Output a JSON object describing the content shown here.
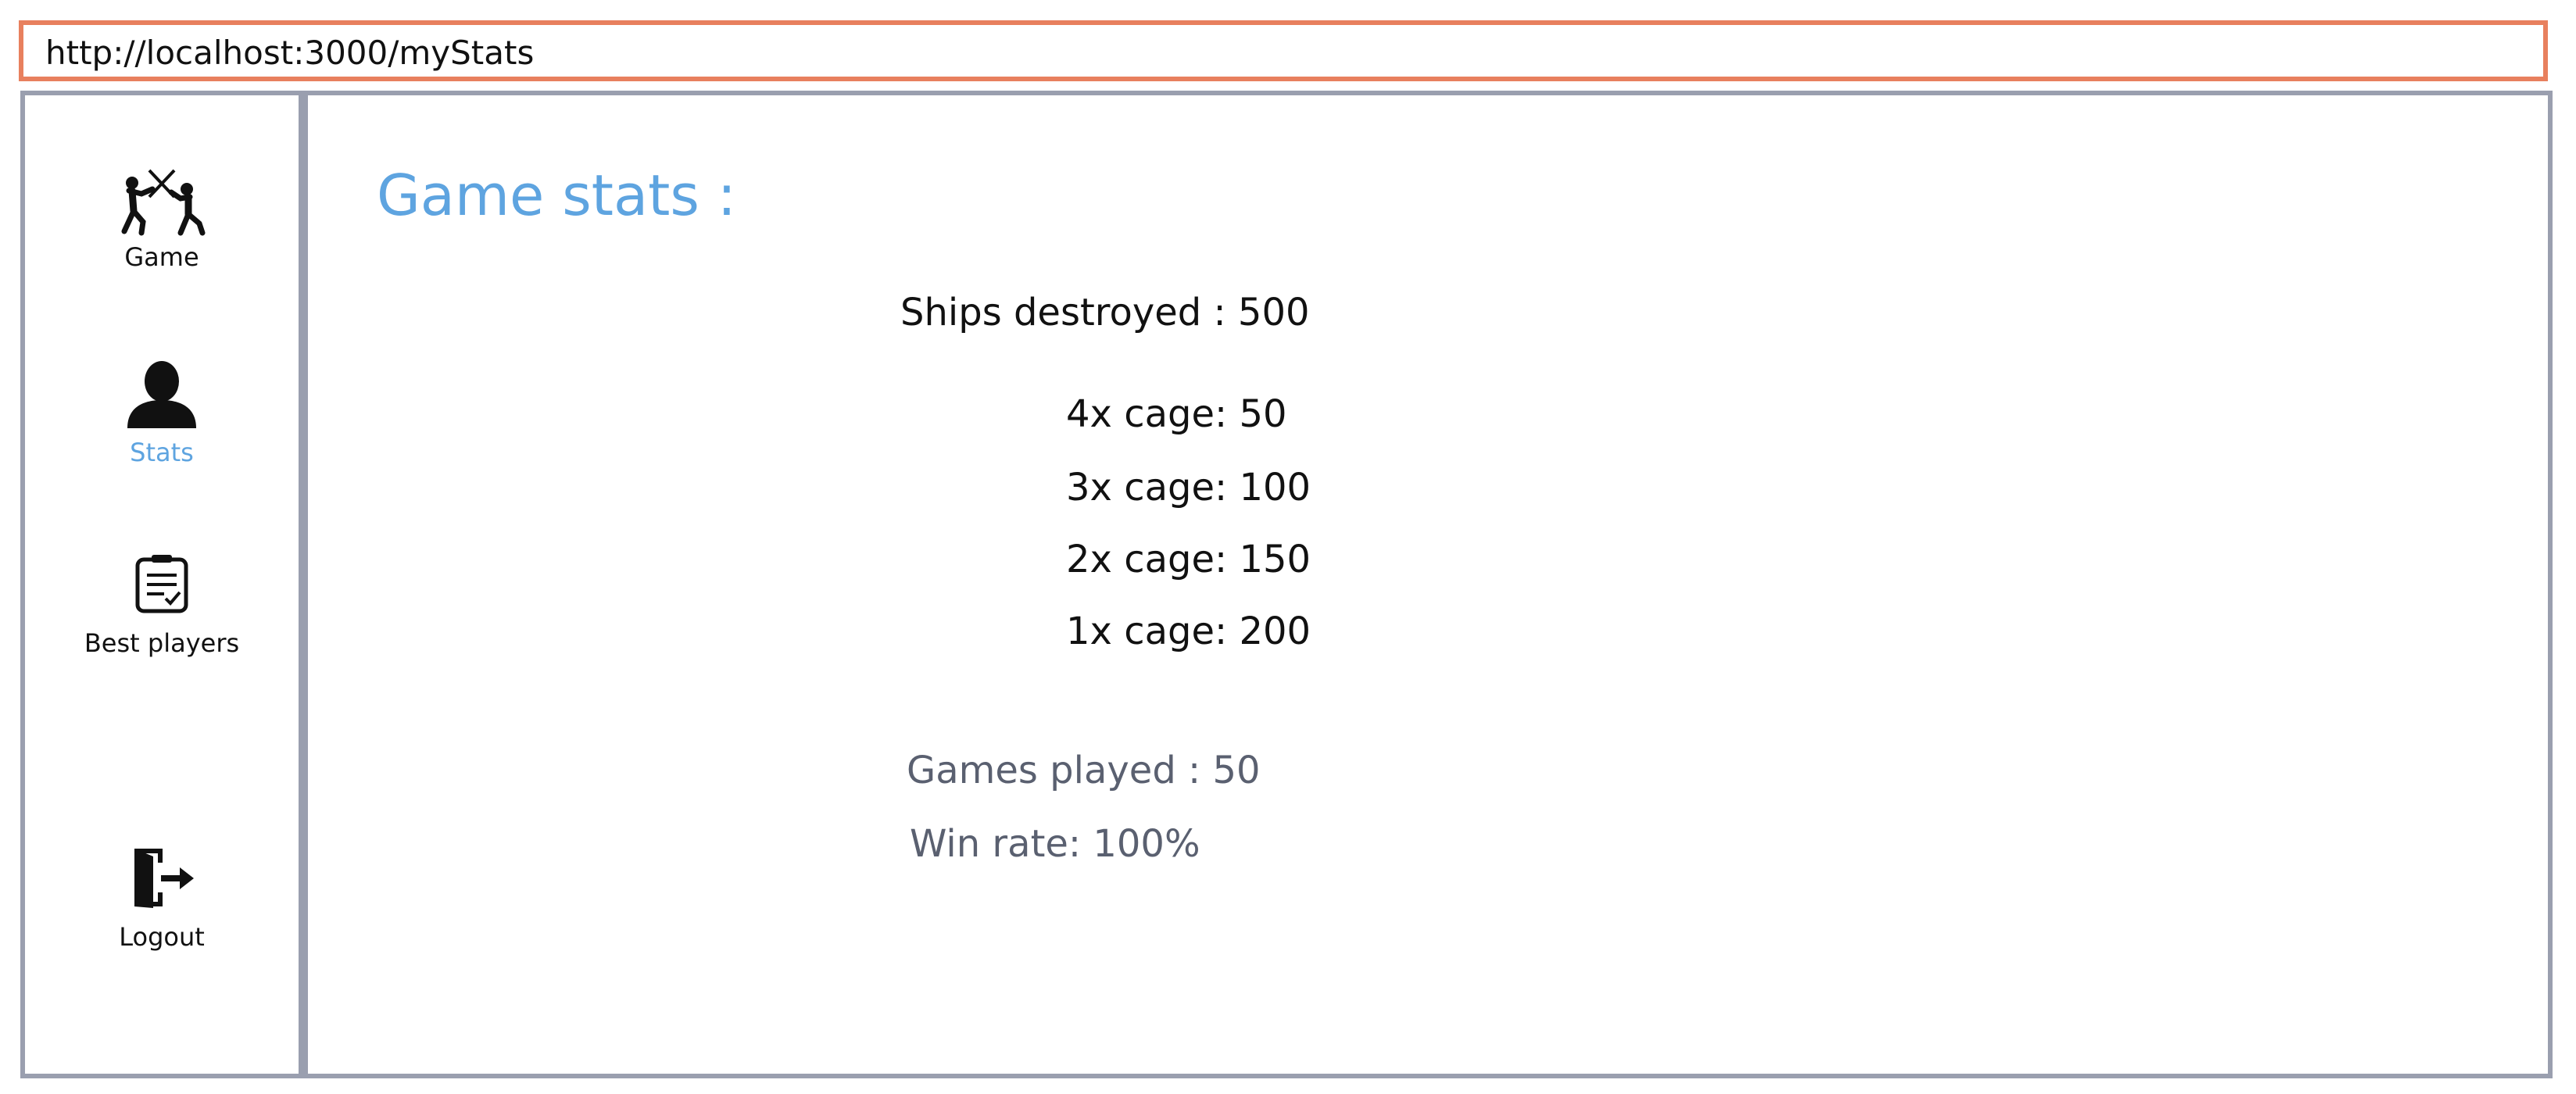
{
  "browser": {
    "url": "http://localhost:3000/myStats"
  },
  "sidebar": {
    "items": [
      {
        "label": "Game",
        "icon": "fencing-icon"
      },
      {
        "label": "Stats",
        "icon": "user-icon",
        "active": true
      },
      {
        "label": "Best players",
        "icon": "clipboard-check-icon"
      },
      {
        "label": "Logout",
        "icon": "logout-door-icon"
      }
    ],
    "active_color": "#5ea4e0"
  },
  "main": {
    "title": "Game stats :",
    "ships_destroyed": "Ships destroyed : 500",
    "cages": [
      "4x cage: 50",
      "3x cage: 100",
      "2x cage: 150",
      "1x cage: 200"
    ],
    "games_played": "Games played : 50",
    "win_rate": "Win rate: 100%"
  },
  "colors": {
    "url_border": "#e8805e",
    "frame_border": "#9a9faf",
    "title": "#5ea4e0",
    "secondary_text": "#5a6070"
  }
}
